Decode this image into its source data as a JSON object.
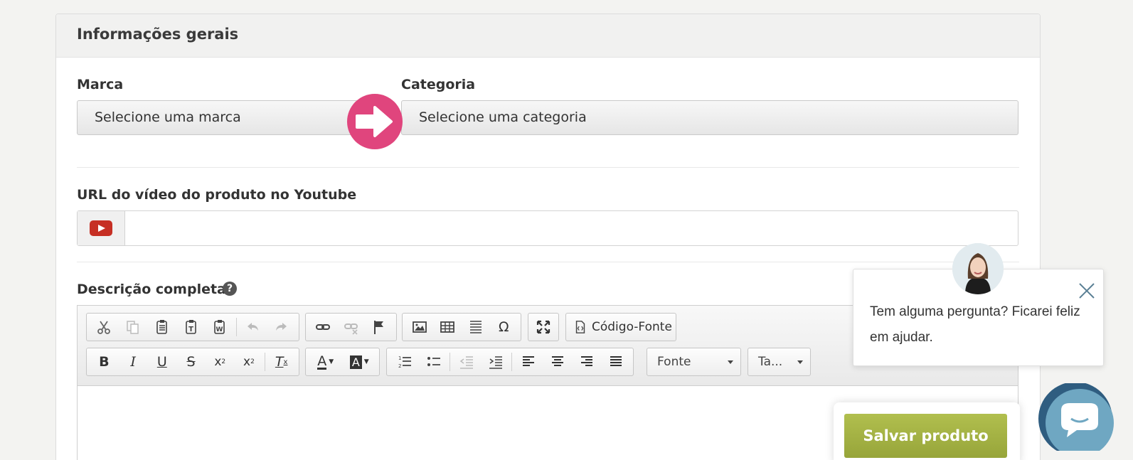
{
  "section": {
    "title": "Informações gerais"
  },
  "brand": {
    "label": "Marca",
    "value": "Selecione uma marca"
  },
  "category": {
    "label": "Categoria",
    "value": "Selecione uma categoria"
  },
  "video": {
    "label": "URL do vídeo do produto no Youtube",
    "value": ""
  },
  "description": {
    "label": "Descrição completa",
    "help_icon": "?",
    "toolbar": {
      "source_button": "Código-Fonte",
      "font_select": "Fonte",
      "size_select": "Ta..."
    }
  },
  "chat": {
    "message": "Tem alguma pergunta? Ficarei feliz em ajudar."
  },
  "actions": {
    "save": "Salvar produto"
  },
  "colors": {
    "accent_pink": "#e0457d",
    "save_green": "#a3b144",
    "chat_blue": "#6fa7c2"
  }
}
